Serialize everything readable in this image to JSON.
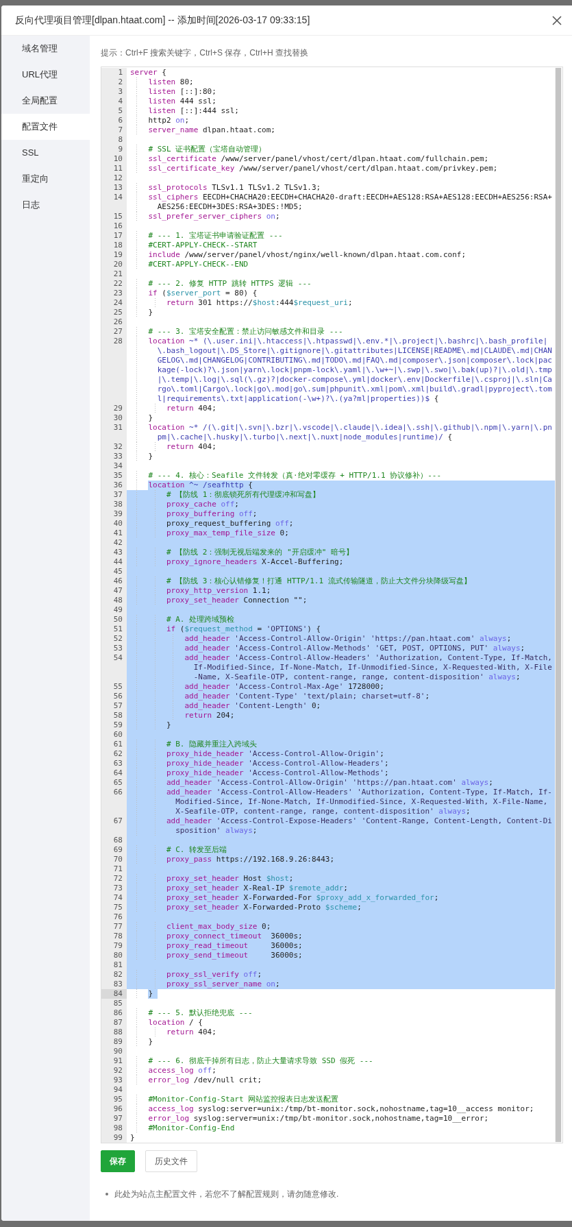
{
  "dialog": {
    "title": "反向代理项目管理[dlpan.htaat.com] -- 添加时间[2026-03-17 09:33:15]"
  },
  "sidebar": {
    "items": [
      {
        "label": "域名管理",
        "selected": false
      },
      {
        "label": "URL代理",
        "selected": false
      },
      {
        "label": "全局配置",
        "selected": false
      },
      {
        "label": "配置文件",
        "selected": true
      },
      {
        "label": "SSL",
        "selected": false
      },
      {
        "label": "重定向",
        "selected": false
      },
      {
        "label": "日志",
        "selected": false
      }
    ]
  },
  "hint": "提示：Ctrl+F 搜索关键字，Ctrl+S 保存，Ctrl+H 查找替换",
  "editor": {
    "lines": [
      {
        "n": "1",
        "sel": false,
        "act": false,
        "t": [
          {
            "kind": "keyword",
            "text": "server"
          },
          {
            "kind": "plain",
            "text": " {"
          }
        ]
      },
      {
        "n": "2",
        "sel": false,
        "act": false,
        "t": [
          {
            "kind": "keyword",
            "text": "    listen"
          },
          {
            "kind": "plain",
            "text": " 80;"
          }
        ]
      },
      {
        "n": "3",
        "sel": false,
        "act": false,
        "t": [
          {
            "kind": "keyword",
            "text": "    listen"
          },
          {
            "kind": "plain",
            "text": " [::]:80;"
          }
        ]
      },
      {
        "n": "4",
        "sel": false,
        "act": false,
        "t": [
          {
            "kind": "keyword",
            "text": "    listen"
          },
          {
            "kind": "plain",
            "text": " 444 ssl;"
          }
        ]
      },
      {
        "n": "5",
        "sel": false,
        "act": false,
        "t": [
          {
            "kind": "keyword",
            "text": "    listen"
          },
          {
            "kind": "plain",
            "text": " [::]:444 ssl;"
          }
        ]
      },
      {
        "n": "6",
        "sel": false,
        "act": false,
        "t": [
          {
            "kind": "plain",
            "text": "    http2 "
          },
          {
            "kind": "atom",
            "text": "on"
          },
          {
            "kind": "plain",
            "text": ";"
          }
        ]
      },
      {
        "n": "7",
        "sel": false,
        "act": false,
        "t": [
          {
            "kind": "keyword",
            "text": "    server_name"
          },
          {
            "kind": "plain",
            "text": " dlpan.htaat.com;"
          }
        ]
      },
      {
        "n": "8",
        "sel": false,
        "act": false
      },
      {
        "n": "9",
        "sel": false,
        "act": false,
        "t": [
          {
            "kind": "comment",
            "text": "    # SSL 证书配置（宝塔自动管理）"
          }
        ]
      },
      {
        "n": "10",
        "sel": false,
        "act": false,
        "t": [
          {
            "kind": "keyword",
            "text": "    ssl_certificate"
          },
          {
            "kind": "plain",
            "text": " /www/server/panel/vhost/cert/dlpan.htaat.com/fullchain.pem;"
          }
        ]
      },
      {
        "n": "11",
        "sel": false,
        "act": false,
        "t": [
          {
            "kind": "keyword",
            "text": "    ssl_certificate_key"
          },
          {
            "kind": "plain",
            "text": " /www/server/panel/vhost/cert/dlpan.htaat.com/privkey.pem;"
          }
        ]
      },
      {
        "n": "12",
        "sel": false,
        "act": false
      },
      {
        "n": "13",
        "sel": false,
        "act": false,
        "t": [
          {
            "kind": "keyword",
            "text": "    ssl_protocols"
          },
          {
            "kind": "plain",
            "text": " TLSv1.1 TLSv1.2 TLSv1.3;"
          }
        ]
      },
      {
        "n": "14",
        "sel": false,
        "act": false,
        "t": [
          {
            "kind": "keyword",
            "text": "    ssl_ciphers"
          },
          {
            "kind": "plain",
            "text": " EECDH+CHACHA20:EECDH+CHACHA20-draft:EECDH+AES128:RSA+AES128:EECDH+AES256:RSA+AES256:EECDH+3DES:RSA+3DES:!MD5;"
          }
        ]
      },
      {
        "n": "15",
        "sel": false,
        "act": false,
        "t": [
          {
            "kind": "keyword",
            "text": "    ssl_prefer_server_ciphers"
          },
          {
            "kind": "atom",
            "text": " on"
          },
          {
            "kind": "plain",
            "text": ";"
          }
        ]
      },
      {
        "n": "16",
        "sel": false,
        "act": false
      },
      {
        "n": "17",
        "sel": false,
        "act": false,
        "t": [
          {
            "kind": "comment",
            "text": "    # --- 1. 宝塔证书申请验证配置 ---"
          }
        ]
      },
      {
        "n": "18",
        "sel": false,
        "act": false,
        "t": [
          {
            "kind": "comment",
            "text": "    #CERT-APPLY-CHECK--START"
          }
        ]
      },
      {
        "n": "19",
        "sel": false,
        "act": false,
        "t": [
          {
            "kind": "keyword",
            "text": "    include"
          },
          {
            "kind": "plain",
            "text": " /www/server/panel/vhost/nginx/well-known/dlpan.htaat.com.conf;"
          }
        ]
      },
      {
        "n": "20",
        "sel": false,
        "act": false,
        "t": [
          {
            "kind": "comment",
            "text": "    #CERT-APPLY-CHECK--END"
          }
        ]
      },
      {
        "n": "21",
        "sel": false,
        "act": false
      },
      {
        "n": "22",
        "sel": false,
        "act": false,
        "t": [
          {
            "kind": "comment",
            "text": "    # --- 2. 修复 HTTP 跳转 HTTPS 逻辑 ---"
          }
        ]
      },
      {
        "n": "23",
        "sel": false,
        "act": false,
        "t": [
          {
            "kind": "keyword",
            "text": "    if"
          },
          {
            "kind": "plain",
            "text": " ("
          },
          {
            "kind": "variable",
            "text": "$server_port"
          },
          {
            "kind": "plain",
            "text": " = 80) {"
          }
        ]
      },
      {
        "n": "24",
        "sel": false,
        "act": false,
        "t": [
          {
            "kind": "keyword",
            "text": "        return"
          },
          {
            "kind": "plain",
            "text": " 301 https://"
          },
          {
            "kind": "variable",
            "text": "$host"
          },
          {
            "kind": "plain",
            "text": ":444"
          },
          {
            "kind": "variable",
            "text": "$request_uri"
          },
          {
            "kind": "plain",
            "text": ";"
          }
        ]
      },
      {
        "n": "25",
        "sel": false,
        "act": false,
        "t": [
          {
            "kind": "plain",
            "text": "    }"
          }
        ]
      },
      {
        "n": "26",
        "sel": false,
        "act": false
      },
      {
        "n": "27",
        "sel": false,
        "act": false,
        "t": [
          {
            "kind": "comment",
            "text": "    # --- 3. 宝塔安全配置：禁止访问敏感文件和目录 ---"
          }
        ]
      },
      {
        "n": "28",
        "sel": false,
        "act": false,
        "t": [
          {
            "kind": "keyword",
            "text": "    location"
          },
          {
            "kind": "regex",
            "text": " ~* (\\.user.ini|\\.htaccess|\\.htpasswd|\\.env.*|\\.project|\\.bashrc|\\.bash_profile|\\.bash_logout|\\.DS_Store|\\.gitignore|\\.gitattributes|LICENSE|README\\.md|CLAUDE\\.md|CHANGELOG\\.md|CHANGELOG|CONTRIBUTING\\.md|TODO\\.md|FAQ\\.md|composer\\.json|composer\\.lock|package(-lock)?\\.json|yarn\\.lock|pnpm-lock\\.yaml|\\.\\w+~|\\.swp|\\.swo|\\.bak(up)?|\\.old|\\.tmp|\\.temp|\\.log|\\.sql(\\.gz)?|docker-compose\\.yml|docker\\.env|Dockerfile|\\.csproj|\\.sln|Cargo\\.toml|Cargo\\.lock|go\\.mod|go\\.sum|phpunit\\.xml|pom\\.xml|build\\.gradl|pyproject\\.toml|requirements\\.txt|application(-\\w+)?\\.(ya?ml|properties))$"
          },
          {
            "kind": "plain",
            "text": " {"
          }
        ]
      },
      {
        "n": "29",
        "sel": false,
        "act": false,
        "t": [
          {
            "kind": "keyword",
            "text": "        return"
          },
          {
            "kind": "plain",
            "text": " 404;"
          }
        ]
      },
      {
        "n": "30",
        "sel": false,
        "act": false,
        "t": [
          {
            "kind": "plain",
            "text": "    }"
          }
        ]
      },
      {
        "n": "31",
        "sel": false,
        "act": false,
        "t": [
          {
            "kind": "keyword",
            "text": "    location"
          },
          {
            "kind": "regex",
            "text": " ~* /(\\.git|\\.svn|\\.bzr|\\.vscode|\\.claude|\\.idea|\\.ssh|\\.github|\\.npm|\\.yarn|\\.pnpm|\\.cache|\\.husky|\\.turbo|\\.next|\\.nuxt|node_modules|runtime)/"
          },
          {
            "kind": "plain",
            "text": " {"
          }
        ]
      },
      {
        "n": "32",
        "sel": false,
        "act": false,
        "t": [
          {
            "kind": "keyword",
            "text": "        return"
          },
          {
            "kind": "plain",
            "text": " 404;"
          }
        ]
      },
      {
        "n": "33",
        "sel": false,
        "act": false,
        "t": [
          {
            "kind": "plain",
            "text": "    }"
          }
        ]
      },
      {
        "n": "34",
        "sel": false,
        "act": false
      },
      {
        "n": "35",
        "sel": false,
        "act": false,
        "t": [
          {
            "kind": "comment",
            "text": "    # --- 4. 核心：Seafile 文件转发（真·绝对零缓存 + HTTP/1.1 协议修补）---"
          }
        ]
      },
      {
        "n": "36",
        "sel": true,
        "act": false,
        "t": [
          {
            "kind": "keyword",
            "text": "    location"
          },
          {
            "kind": "regex",
            "text": " ^~ /seafhttp"
          },
          {
            "kind": "plain",
            "text": " {"
          }
        ]
      },
      {
        "n": "37",
        "sel": true,
        "act": false,
        "t": [
          {
            "kind": "comment",
            "text": "        # 【防线 1：彻底锁死所有代理缓冲和写盘】"
          }
        ]
      },
      {
        "n": "38",
        "sel": true,
        "act": false,
        "t": [
          {
            "kind": "keyword",
            "text": "        proxy_cache"
          },
          {
            "kind": "atom",
            "text": " off"
          },
          {
            "kind": "plain",
            "text": ";"
          }
        ]
      },
      {
        "n": "39",
        "sel": true,
        "act": false,
        "t": [
          {
            "kind": "keyword",
            "text": "        proxy_buffering"
          },
          {
            "kind": "atom",
            "text": " off"
          },
          {
            "kind": "plain",
            "text": ";"
          }
        ]
      },
      {
        "n": "40",
        "sel": true,
        "act": false,
        "t": [
          {
            "kind": "plain",
            "text": "        proxy_request_buffering"
          },
          {
            "kind": "atom",
            "text": " off"
          },
          {
            "kind": "plain",
            "text": ";"
          }
        ]
      },
      {
        "n": "41",
        "sel": true,
        "act": false,
        "t": [
          {
            "kind": "keyword",
            "text": "        proxy_max_temp_file_size"
          },
          {
            "kind": "plain",
            "text": " 0;"
          }
        ]
      },
      {
        "n": "42",
        "sel": true,
        "act": false
      },
      {
        "n": "43",
        "sel": true,
        "act": false,
        "t": [
          {
            "kind": "comment",
            "text": "        # 【防线 2：强制无视后端发来的 \"开启缓冲\" 暗号】"
          }
        ]
      },
      {
        "n": "44",
        "sel": true,
        "act": false,
        "t": [
          {
            "kind": "keyword",
            "text": "        proxy_ignore_headers"
          },
          {
            "kind": "plain",
            "text": " X-Accel-Buffering;"
          }
        ]
      },
      {
        "n": "45",
        "sel": true,
        "act": false
      },
      {
        "n": "46",
        "sel": true,
        "act": false,
        "t": [
          {
            "kind": "comment",
            "text": "        # 【防线 3：核心认错修复！打通 HTTP/1.1 流式传输隧道，防止大文件分块降级写盘】"
          }
        ]
      },
      {
        "n": "47",
        "sel": true,
        "act": false,
        "t": [
          {
            "kind": "keyword",
            "text": "        proxy_http_version"
          },
          {
            "kind": "plain",
            "text": " 1.1;"
          }
        ]
      },
      {
        "n": "48",
        "sel": true,
        "act": false,
        "t": [
          {
            "kind": "keyword",
            "text": "        proxy_set_header"
          },
          {
            "kind": "plain",
            "text": " Connection \"\";"
          }
        ]
      },
      {
        "n": "49",
        "sel": true,
        "act": false
      },
      {
        "n": "50",
        "sel": true,
        "act": false,
        "t": [
          {
            "kind": "comment",
            "text": "        # A. 处理跨域预检"
          }
        ]
      },
      {
        "n": "51",
        "sel": true,
        "act": false,
        "t": [
          {
            "kind": "keyword",
            "text": "        if"
          },
          {
            "kind": "plain",
            "text": " ("
          },
          {
            "kind": "variable",
            "text": "$request_method"
          },
          {
            "kind": "plain",
            "text": " = "
          },
          {
            "kind": "string",
            "text": "'OPTIONS'"
          },
          {
            "kind": "plain",
            "text": ") {"
          }
        ]
      },
      {
        "n": "52",
        "sel": true,
        "act": false,
        "t": [
          {
            "kind": "keyword",
            "text": "            add_header"
          },
          {
            "kind": "string",
            "text": " 'Access-Control-Allow-Origin' 'https://pan.htaat.com'"
          },
          {
            "kind": "atom",
            "text": " always"
          },
          {
            "kind": "plain",
            "text": ";"
          }
        ]
      },
      {
        "n": "53",
        "sel": true,
        "act": false,
        "t": [
          {
            "kind": "keyword",
            "text": "            add_header"
          },
          {
            "kind": "string",
            "text": " 'Access-Control-Allow-Methods' 'GET, POST, OPTIONS, PUT'"
          },
          {
            "kind": "atom",
            "text": " always"
          },
          {
            "kind": "plain",
            "text": ";"
          }
        ]
      },
      {
        "n": "54",
        "sel": true,
        "act": false,
        "t": [
          {
            "kind": "keyword",
            "text": "            add_header"
          },
          {
            "kind": "string",
            "text": " 'Access-Control-Allow-Headers' 'Authorization, Content-Type, If-Match, If-Modified-Since, If-None-Match, If-Unmodified-Since, X-Requested-With, X-File-Name, X-Seafile-OTP, content-range, range, content-disposition'"
          },
          {
            "kind": "atom",
            "text": " always"
          },
          {
            "kind": "plain",
            "text": ";"
          }
        ]
      },
      {
        "n": "55",
        "sel": true,
        "act": false,
        "t": [
          {
            "kind": "keyword",
            "text": "            add_header"
          },
          {
            "kind": "string",
            "text": " 'Access-Control-Max-Age'"
          },
          {
            "kind": "plain",
            "text": " 1728000;"
          }
        ]
      },
      {
        "n": "56",
        "sel": true,
        "act": false,
        "t": [
          {
            "kind": "keyword",
            "text": "            add_header"
          },
          {
            "kind": "string",
            "text": " 'Content-Type' 'text/plain; charset=utf-8'"
          },
          {
            "kind": "plain",
            "text": ";"
          }
        ]
      },
      {
        "n": "57",
        "sel": true,
        "act": false,
        "t": [
          {
            "kind": "keyword",
            "text": "            add_header"
          },
          {
            "kind": "string",
            "text": " 'Content-Length'"
          },
          {
            "kind": "plain",
            "text": " 0;"
          }
        ]
      },
      {
        "n": "58",
        "sel": true,
        "act": false,
        "t": [
          {
            "kind": "keyword",
            "text": "            return"
          },
          {
            "kind": "plain",
            "text": " 204;"
          }
        ]
      },
      {
        "n": "59",
        "sel": true,
        "act": false,
        "t": [
          {
            "kind": "plain",
            "text": "        }"
          }
        ]
      },
      {
        "n": "60",
        "sel": true,
        "act": false
      },
      {
        "n": "61",
        "sel": true,
        "act": false,
        "t": [
          {
            "kind": "comment",
            "text": "        # B. 隐藏并重注入跨域头"
          }
        ]
      },
      {
        "n": "62",
        "sel": true,
        "act": false,
        "t": [
          {
            "kind": "keyword",
            "text": "        proxy_hide_header"
          },
          {
            "kind": "string",
            "text": " 'Access-Control-Allow-Origin'"
          },
          {
            "kind": "plain",
            "text": ";"
          }
        ]
      },
      {
        "n": "63",
        "sel": true,
        "act": false,
        "t": [
          {
            "kind": "keyword",
            "text": "        proxy_hide_header"
          },
          {
            "kind": "string",
            "text": " 'Access-Control-Allow-Headers'"
          },
          {
            "kind": "plain",
            "text": ";"
          }
        ]
      },
      {
        "n": "64",
        "sel": true,
        "act": false,
        "t": [
          {
            "kind": "keyword",
            "text": "        proxy_hide_header"
          },
          {
            "kind": "string",
            "text": " 'Access-Control-Allow-Methods'"
          },
          {
            "kind": "plain",
            "text": ";"
          }
        ]
      },
      {
        "n": "65",
        "sel": true,
        "act": false,
        "t": [
          {
            "kind": "keyword",
            "text": "        add_header"
          },
          {
            "kind": "string",
            "text": " 'Access-Control-Allow-Origin' 'https://pan.htaat.com'"
          },
          {
            "kind": "atom",
            "text": " always"
          },
          {
            "kind": "plain",
            "text": ";"
          }
        ]
      },
      {
        "n": "66",
        "sel": true,
        "act": false,
        "t": [
          {
            "kind": "keyword",
            "text": "        add_header"
          },
          {
            "kind": "string",
            "text": " 'Access-Control-Allow-Headers' 'Authorization, Content-Type, If-Match, If-Modified-Since, If-None-Match, If-Unmodified-Since, X-Requested-With, X-File-Name, X-Seafile-OTP, content-range, range, content-disposition'"
          },
          {
            "kind": "atom",
            "text": " always"
          },
          {
            "kind": "plain",
            "text": ";"
          }
        ]
      },
      {
        "n": "67",
        "sel": true,
        "act": false,
        "t": [
          {
            "kind": "keyword",
            "text": "        add_header"
          },
          {
            "kind": "string",
            "text": " 'Access-Control-Expose-Headers' 'Content-Range, Content-Length, Content-Disposition'"
          },
          {
            "kind": "atom",
            "text": " always"
          },
          {
            "kind": "plain",
            "text": ";"
          }
        ]
      },
      {
        "n": "68",
        "sel": true,
        "act": false
      },
      {
        "n": "69",
        "sel": true,
        "act": false,
        "t": [
          {
            "kind": "comment",
            "text": "        # C. 转发至后端"
          }
        ]
      },
      {
        "n": "70",
        "sel": true,
        "act": false,
        "t": [
          {
            "kind": "keyword",
            "text": "        proxy_pass"
          },
          {
            "kind": "plain",
            "text": " https://192.168.9.26:8443;"
          }
        ]
      },
      {
        "n": "71",
        "sel": true,
        "act": false
      },
      {
        "n": "72",
        "sel": true,
        "act": false,
        "t": [
          {
            "kind": "keyword",
            "text": "        proxy_set_header"
          },
          {
            "kind": "plain",
            "text": " Host "
          },
          {
            "kind": "variable",
            "text": "$host"
          },
          {
            "kind": "plain",
            "text": ";"
          }
        ]
      },
      {
        "n": "73",
        "sel": true,
        "act": false,
        "t": [
          {
            "kind": "keyword",
            "text": "        proxy_set_header"
          },
          {
            "kind": "plain",
            "text": " X-Real-IP "
          },
          {
            "kind": "variable",
            "text": "$remote_addr"
          },
          {
            "kind": "plain",
            "text": ";"
          }
        ]
      },
      {
        "n": "74",
        "sel": true,
        "act": false,
        "t": [
          {
            "kind": "keyword",
            "text": "        proxy_set_header"
          },
          {
            "kind": "plain",
            "text": " X-Forwarded-For "
          },
          {
            "kind": "variable",
            "text": "$proxy_add_x_forwarded_for"
          },
          {
            "kind": "plain",
            "text": ";"
          }
        ]
      },
      {
        "n": "75",
        "sel": true,
        "act": false,
        "t": [
          {
            "kind": "keyword",
            "text": "        proxy_set_header"
          },
          {
            "kind": "plain",
            "text": " X-Forwarded-Proto "
          },
          {
            "kind": "variable",
            "text": "$scheme"
          },
          {
            "kind": "plain",
            "text": ";"
          }
        ]
      },
      {
        "n": "76",
        "sel": true,
        "act": false
      },
      {
        "n": "77",
        "sel": true,
        "act": false,
        "t": [
          {
            "kind": "keyword",
            "text": "        client_max_body_size"
          },
          {
            "kind": "plain",
            "text": " 0;"
          }
        ]
      },
      {
        "n": "78",
        "sel": true,
        "act": false,
        "t": [
          {
            "kind": "keyword",
            "text": "        proxy_connect_timeout"
          },
          {
            "kind": "plain",
            "text": "  36000s;"
          }
        ]
      },
      {
        "n": "79",
        "sel": true,
        "act": false,
        "t": [
          {
            "kind": "keyword",
            "text": "        proxy_read_timeout"
          },
          {
            "kind": "plain",
            "text": "     36000s;"
          }
        ]
      },
      {
        "n": "80",
        "sel": true,
        "act": false,
        "t": [
          {
            "kind": "keyword",
            "text": "        proxy_send_timeout"
          },
          {
            "kind": "plain",
            "text": "     36000s;"
          }
        ]
      },
      {
        "n": "81",
        "sel": true,
        "act": false
      },
      {
        "n": "82",
        "sel": true,
        "act": false,
        "t": [
          {
            "kind": "keyword",
            "text": "        proxy_ssl_verify"
          },
          {
            "kind": "atom",
            "text": " off"
          },
          {
            "kind": "plain",
            "text": ";"
          }
        ]
      },
      {
        "n": "83",
        "sel": true,
        "act": false,
        "t": [
          {
            "kind": "keyword",
            "text": "        proxy_ssl_server_name"
          },
          {
            "kind": "atom",
            "text": " on"
          },
          {
            "kind": "plain",
            "text": ";"
          }
        ]
      },
      {
        "n": "84",
        "sel": true,
        "act": true,
        "t": [
          {
            "kind": "plain",
            "text": "    }"
          }
        ]
      },
      {
        "n": "85",
        "sel": false,
        "act": false
      },
      {
        "n": "86",
        "sel": false,
        "act": false,
        "t": [
          {
            "kind": "comment",
            "text": "    # --- 5. 默认拒绝兜底 ---"
          }
        ]
      },
      {
        "n": "87",
        "sel": false,
        "act": false,
        "t": [
          {
            "kind": "keyword",
            "text": "    location"
          },
          {
            "kind": "plain",
            "text": " / {"
          }
        ]
      },
      {
        "n": "88",
        "sel": false,
        "act": false,
        "t": [
          {
            "kind": "keyword",
            "text": "        return"
          },
          {
            "kind": "plain",
            "text": " 404;"
          }
        ]
      },
      {
        "n": "89",
        "sel": false,
        "act": false,
        "t": [
          {
            "kind": "plain",
            "text": "    }"
          }
        ]
      },
      {
        "n": "90",
        "sel": false,
        "act": false
      },
      {
        "n": "91",
        "sel": false,
        "act": false,
        "t": [
          {
            "kind": "comment",
            "text": "    # --- 6. 彻底干掉所有日志，防止大量请求导致 SSD 假死 ---"
          }
        ]
      },
      {
        "n": "92",
        "sel": false,
        "act": false,
        "t": [
          {
            "kind": "keyword",
            "text": "    access_log"
          },
          {
            "kind": "atom",
            "text": " off"
          },
          {
            "kind": "plain",
            "text": ";"
          }
        ]
      },
      {
        "n": "93",
        "sel": false,
        "act": false,
        "t": [
          {
            "kind": "keyword",
            "text": "    error_log"
          },
          {
            "kind": "plain",
            "text": " /dev/null crit;"
          }
        ]
      },
      {
        "n": "94",
        "sel": false,
        "act": false
      },
      {
        "n": "95",
        "sel": false,
        "act": false,
        "t": [
          {
            "kind": "comment",
            "text": "    #Monitor-Config-Start 网站监控报表日志发送配置"
          }
        ]
      },
      {
        "n": "96",
        "sel": false,
        "act": false,
        "t": [
          {
            "kind": "keyword",
            "text": "    access_log"
          },
          {
            "kind": "plain",
            "text": " syslog:server=unix:/tmp/bt-monitor.sock,nohostname,tag=10__access monitor;"
          }
        ]
      },
      {
        "n": "97",
        "sel": false,
        "act": false,
        "t": [
          {
            "kind": "keyword",
            "text": "    error_log"
          },
          {
            "kind": "plain",
            "text": " syslog:server=unix:/tmp/bt-monitor.sock,nohostname,tag=10__error;"
          }
        ]
      },
      {
        "n": "98",
        "sel": false,
        "act": false,
        "t": [
          {
            "kind": "comment",
            "text": "    #Monitor-Config-End"
          }
        ]
      },
      {
        "n": "99",
        "sel": false,
        "act": false,
        "t": [
          {
            "kind": "plain",
            "text": "}"
          }
        ]
      }
    ]
  },
  "buttons": [
    {
      "label": "保存",
      "kind": "primary"
    },
    {
      "label": "历史文件",
      "kind": "default"
    }
  ],
  "notes": [
    "此处为站点主配置文件，若您不了解配置规则，请勿随意修改."
  ]
}
